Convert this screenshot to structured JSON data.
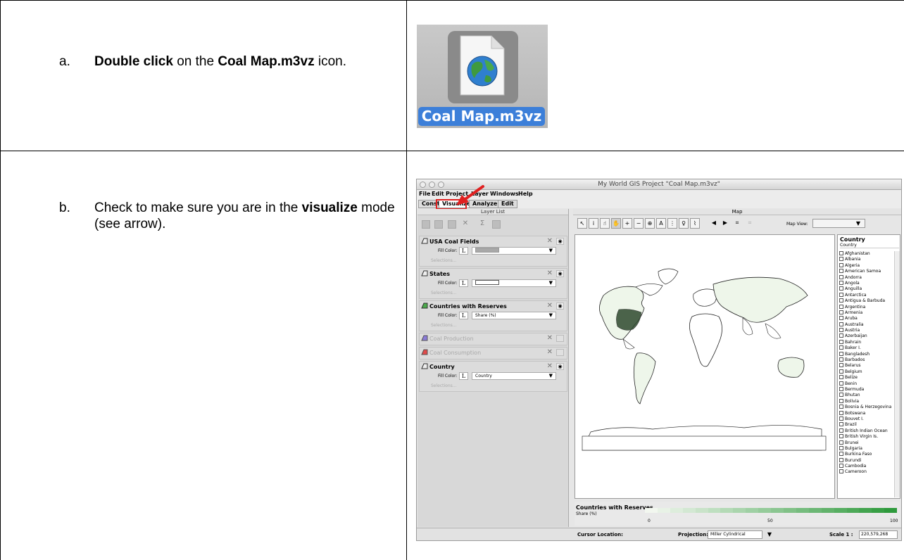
{
  "steps": [
    {
      "letter": "a.",
      "bold1": "Double click",
      "text1": " on the ",
      "bold2": "Coal Map.m3vz",
      "text2": " icon."
    },
    {
      "letter": "b.",
      "text1": "Check to make sure you are in the ",
      "bold1": "visualize",
      "text2": " mode (see arrow)."
    }
  ],
  "file_icon": {
    "label": "Coal Map.m3vz",
    "icon": "globe-document-icon"
  },
  "app": {
    "title": "My World GIS Project \"Coal Map.m3vz\"",
    "menus": [
      "File",
      "Edit",
      "Project",
      "Layer",
      "Windows",
      "Help"
    ],
    "tabs": [
      "Construct",
      "Visualize",
      "Analyze",
      "Edit"
    ],
    "active_tab": "Visualize",
    "layer_list_title": "Layer List",
    "map_title": "Map",
    "fill_color_label": "Fill Color:",
    "selections_label": "Selections...",
    "layers": [
      {
        "name": "USA Coal Fields",
        "fill": "",
        "color": "#a8a8a8",
        "dim": false
      },
      {
        "name": "States",
        "fill": "",
        "color": "#ffffff",
        "dim": false
      },
      {
        "name": "Countries with Reserves",
        "fill": "Share (%)",
        "color": "#ffffff",
        "dim": false
      },
      {
        "name": "Coal Production",
        "dim": true
      },
      {
        "name": "Coal Consumption",
        "dim": true
      },
      {
        "name": "Country",
        "fill": "Country",
        "color": "#ffffff",
        "dim": false
      }
    ],
    "map_view_label": "Map View:",
    "country_list": {
      "header": "Country",
      "subheader": "Country",
      "items": [
        "Afghanistan",
        "Albania",
        "Algeria",
        "American Samoa",
        "Andorra",
        "Angola",
        "Anguilla",
        "Antarctica",
        "Antigua & Barbuda",
        "Argentina",
        "Armenia",
        "Aruba",
        "Australia",
        "Austria",
        "Azerbaijan",
        "Bahrain",
        "Baker I.",
        "Bangladesh",
        "Barbados",
        "Belarus",
        "Belgium",
        "Belize",
        "Benin",
        "Bermuda",
        "Bhutan",
        "Bolivia",
        "Bosnia & Herzegovina",
        "Botswana",
        "Bouvet I.",
        "Brazil",
        "British Indian Ocean",
        "British Virgin Is.",
        "Brunei",
        "Bulgaria",
        "Burkina Faso",
        "Burundi",
        "Cambodia",
        "Cameroon"
      ]
    },
    "legend": {
      "title": "Countries with Reserves",
      "subtitle": "Share (%)",
      "ticks": [
        "0",
        "50",
        "100"
      ],
      "low_color": "#f2f7ef",
      "high_color": "#2e9a3c"
    },
    "status": {
      "cursor_label": "Cursor Location:",
      "projection_label": "Projection:",
      "projection_value": "Miller Cylindrical",
      "scale_label": "Scale 1 :",
      "scale_value": "220,579,268"
    }
  }
}
